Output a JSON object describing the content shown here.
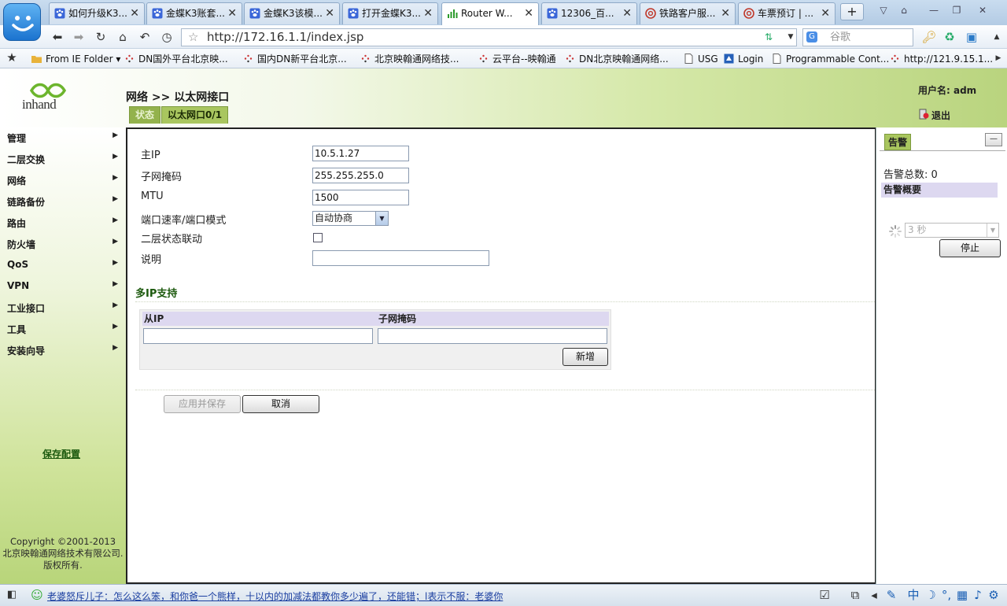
{
  "browser": {
    "tabs": [
      {
        "label": "如何升级K3...",
        "icon": "paw-icon",
        "active": false
      },
      {
        "label": "金蝶K3账套...",
        "icon": "paw-icon",
        "active": false
      },
      {
        "label": "金蝶K3该模...",
        "icon": "paw-icon",
        "active": false
      },
      {
        "label": "打开金蝶K3...",
        "icon": "paw-icon",
        "active": false
      },
      {
        "label": "Router W...",
        "icon": "signal-icon",
        "active": true
      },
      {
        "label": "12306_百...",
        "icon": "paw-icon",
        "active": false
      },
      {
        "label": "铁路客户服...",
        "icon": "rail-icon",
        "active": false
      },
      {
        "label": "车票预订 | ...",
        "icon": "rail-icon",
        "active": false
      }
    ],
    "url": "http://172.16.1.1/index.jsp",
    "search_placeholder": "谷歌",
    "search_engine_letter": "G",
    "bookmarks": [
      {
        "label": "From IE Folder ▾",
        "icon": "folder-icon"
      },
      {
        "label": "DN国外平台北京映...",
        "icon": "loading-icon"
      },
      {
        "label": "国内DN新平台北京...",
        "icon": "loading-icon"
      },
      {
        "label": "北京映翰通网络技...",
        "icon": "loading-icon"
      },
      {
        "label": "云平台--映翰通",
        "icon": "loading-icon"
      },
      {
        "label": "DN北京映翰通网络...",
        "icon": "loading-icon"
      },
      {
        "label": "USG",
        "icon": "page-icon"
      },
      {
        "label": "Login",
        "icon": "login-icon"
      },
      {
        "label": "Programmable Cont...",
        "icon": "page-icon"
      },
      {
        "label": "http://121.9.15.1...",
        "icon": "loading-icon"
      }
    ],
    "status_text": "老婆怒斥儿子：怎么这么笨，和你爸一个熊样，十以内的加减法都教你多少遍了，还能错；l表示不服：老婆你"
  },
  "header": {
    "logo_text": "inhand",
    "breadcrumb": "网络 >> 以太网接口",
    "user_label": "用户名: adm",
    "logout_label": "退出",
    "subtabs": [
      "状态",
      "以太网口0/1"
    ]
  },
  "sidebar": {
    "items": [
      "管理",
      "二层交换",
      "网络",
      "链路备份",
      "路由",
      "防火墙",
      "QoS",
      "VPN",
      "工业接口",
      "工具",
      "安装向导"
    ],
    "save_config": "保存配置",
    "copyright": [
      "Copyright ©2001-2013",
      "北京映翰通网络技术有限公司.",
      "版权所有."
    ]
  },
  "form": {
    "primary_ip_label": "主IP",
    "primary_ip_value": "10.5.1.27",
    "netmask_label": "子网掩码",
    "netmask_value": "255.255.255.0",
    "mtu_label": "MTU",
    "mtu_value": "1500",
    "speed_label": "端口速率/端口模式",
    "speed_value": "自动协商",
    "l2_link_label": "二层状态联动",
    "l2_link_checked": false,
    "desc_label": "说明",
    "desc_value": ""
  },
  "multi_ip": {
    "title": "多IP支持",
    "col_ip": "从IP",
    "col_mask": "子网掩码",
    "add_label": "新增"
  },
  "actions": {
    "apply_label": "应用并保存",
    "cancel_label": "取消"
  },
  "alarm": {
    "tab_label": "告警",
    "total_label": "告警总数: 0",
    "overview_label": "告警概要",
    "refresh_value": "3 秒",
    "stop_label": "停止"
  },
  "colors": {
    "brand_green": "#a9c65f",
    "accent_green": "#1d5a0f",
    "table_header": "#ddd8f0"
  }
}
